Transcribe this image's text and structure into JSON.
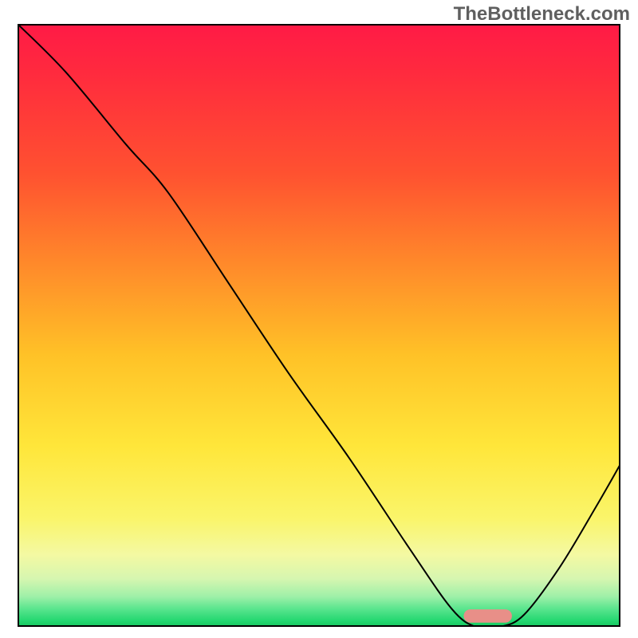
{
  "watermark": "TheBottleneck.com",
  "chart_data": {
    "type": "line",
    "title": "",
    "xlabel": "",
    "ylabel": "",
    "xlim": [
      0,
      100
    ],
    "ylim": [
      0,
      100
    ],
    "grid": false,
    "legend": false,
    "background": "vertical-gradient red→yellow→green (heatmap-style)",
    "series": [
      {
        "name": "bottleneck-curve",
        "color": "#000000",
        "x": [
          0,
          8,
          18,
          25,
          35,
          45,
          55,
          65,
          72,
          76,
          80,
          84,
          90,
          96,
          100
        ],
        "values": [
          100,
          92,
          80,
          72,
          57,
          42,
          28,
          13,
          3,
          0,
          0,
          2,
          10,
          20,
          27
        ]
      }
    ],
    "marker": {
      "name": "optimal-zone",
      "color": "#e88f88",
      "shape": "rounded-bar",
      "x_range": [
        74,
        82
      ],
      "y": 0.7,
      "height": 2.2
    }
  }
}
